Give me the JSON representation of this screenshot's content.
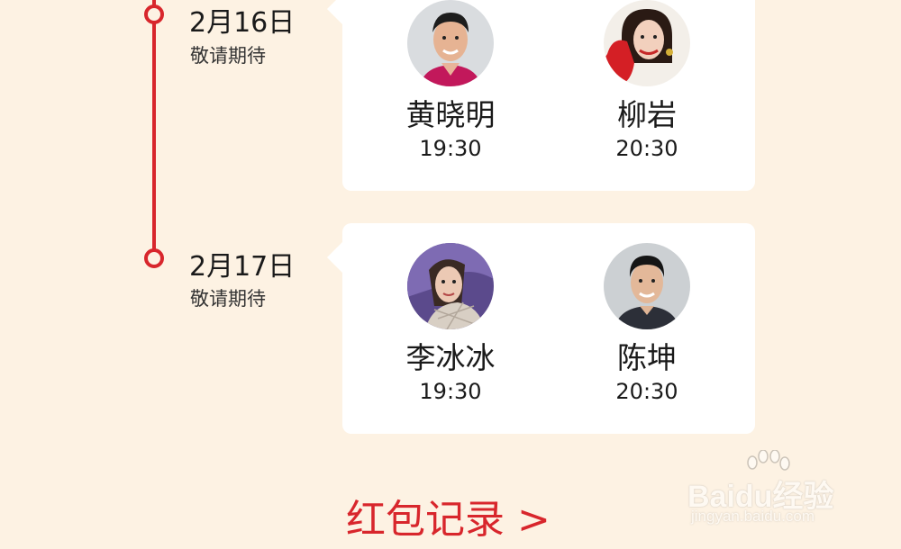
{
  "schedule": [
    {
      "date": "2月16日",
      "subtitle": "敬请期待",
      "stars": [
        {
          "name": "黄晓明",
          "time": "19:30",
          "avatar": "portrait-man-smiling-pink-shirt"
        },
        {
          "name": "柳岩",
          "time": "20:30",
          "avatar": "portrait-woman-red-glove"
        }
      ]
    },
    {
      "date": "2月17日",
      "subtitle": "敬请期待",
      "stars": [
        {
          "name": "李冰冰",
          "time": "19:30",
          "avatar": "portrait-woman-purple-background"
        },
        {
          "name": "陈坤",
          "time": "20:30",
          "avatar": "portrait-man-dark-jacket"
        }
      ]
    }
  ],
  "footer": {
    "records_link": "红包记录 >"
  },
  "watermark": {
    "brand": "Baidu经验",
    "domain": "jingyan.baidu.com"
  },
  "colors": {
    "accent": "#d8262c",
    "background": "#fdf2e3",
    "card": "#ffffff"
  }
}
